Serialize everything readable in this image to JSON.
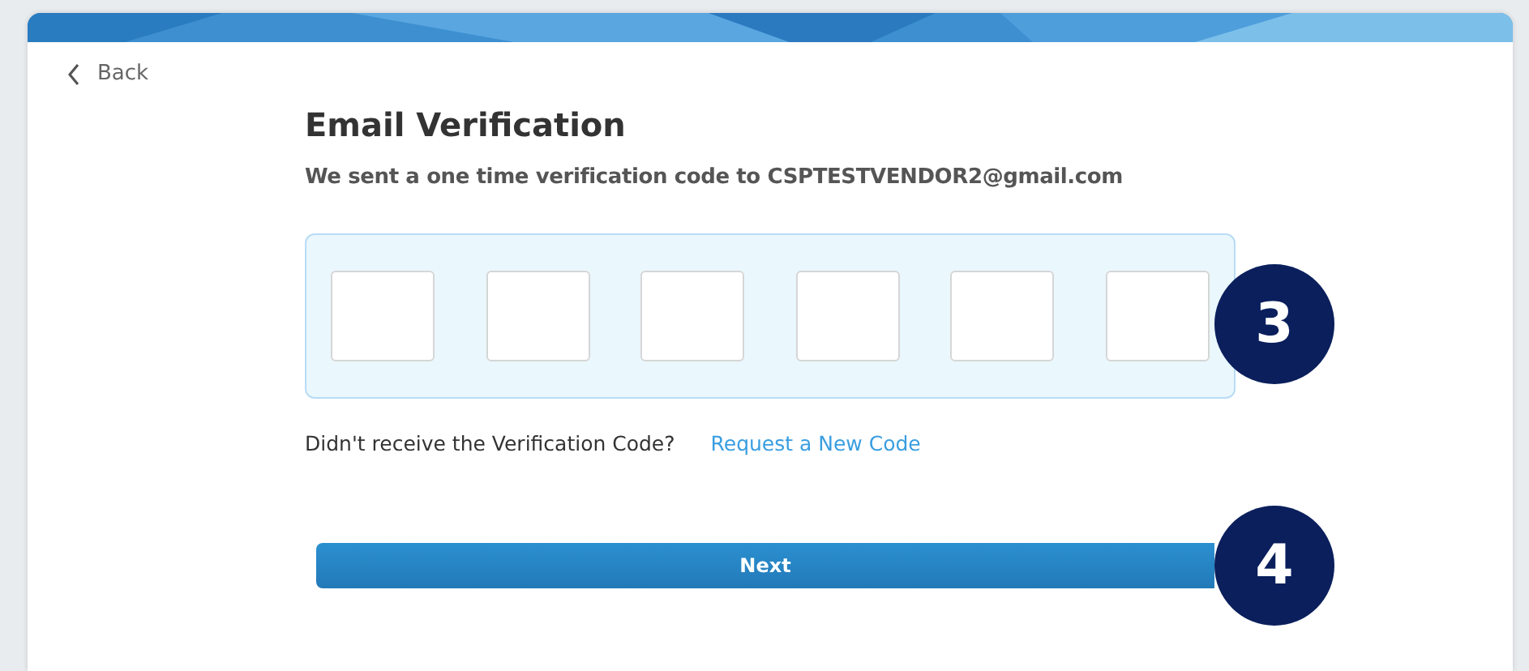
{
  "back": {
    "label": "Back"
  },
  "title": "Email Verification",
  "subtitle": "We sent a one time verification code to CSPTESTVENDOR2@gmail.com",
  "code_fields": [
    {
      "kind": "digit"
    },
    {
      "kind": "digit"
    },
    {
      "kind": "digit"
    },
    {
      "kind": "digit"
    },
    {
      "kind": "digit"
    },
    {
      "kind": "digit"
    }
  ],
  "resend": {
    "prompt": "Didn't receive the Verification Code?",
    "link": "Request a New Code"
  },
  "next_button": "Next",
  "callouts": [
    "3",
    "4"
  ]
}
